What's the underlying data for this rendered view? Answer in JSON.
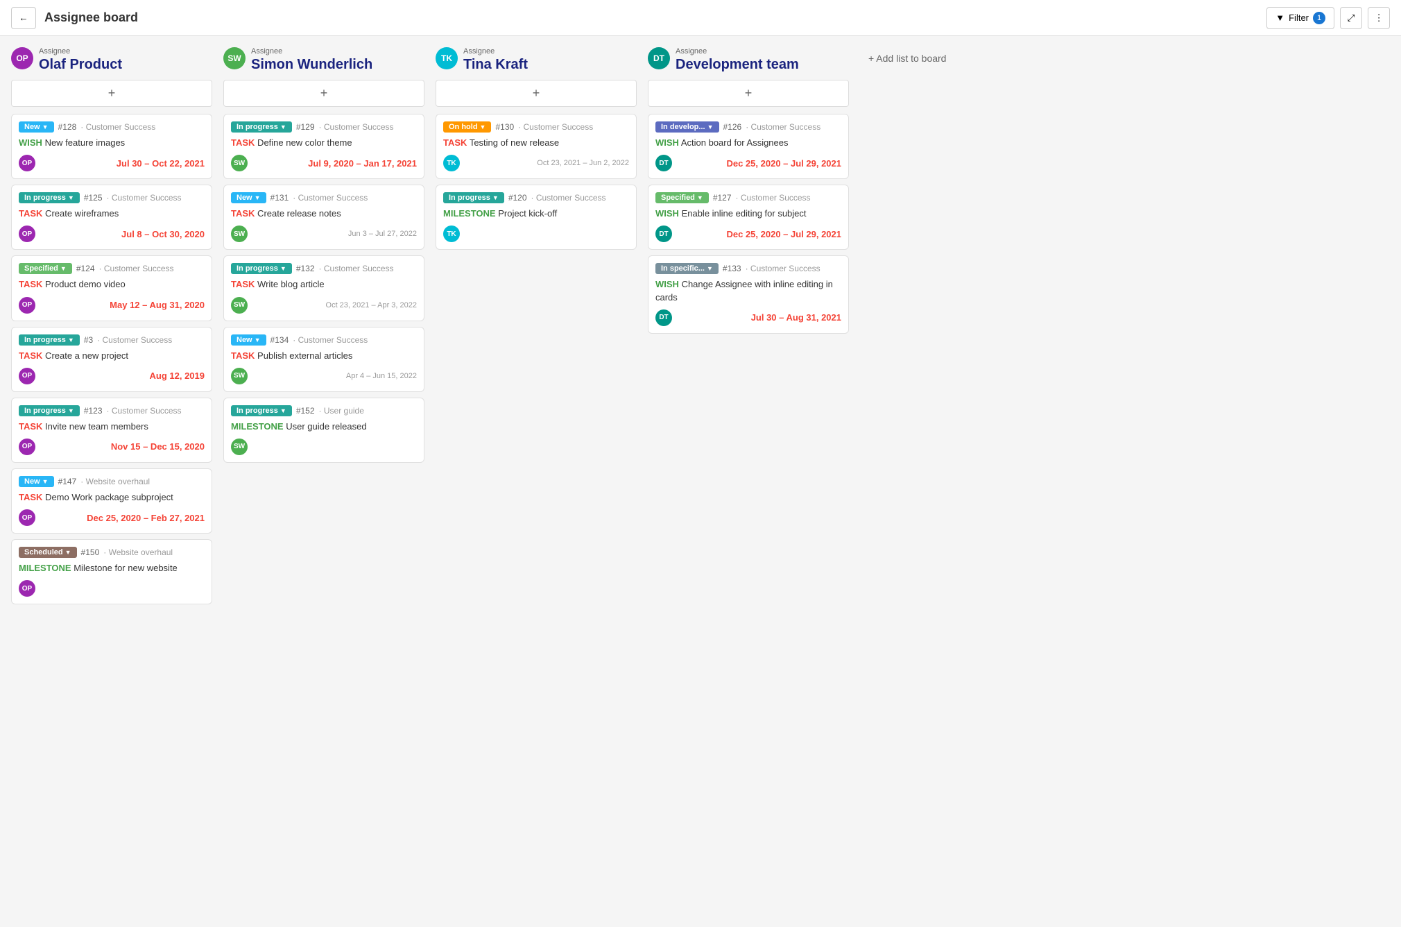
{
  "header": {
    "back_label": "←",
    "title": "Assignee board",
    "filter_label": "Filter",
    "filter_count": "1",
    "expand_icon": "⤢",
    "more_icon": "⋮"
  },
  "add_list_label": "+ Add list to board",
  "columns": [
    {
      "id": "olaf",
      "assignee_label": "Assignee",
      "name": "Olaf Product",
      "avatar_text": "OP",
      "avatar_class": "avatar-op",
      "add_label": "+",
      "cards": [
        {
          "status": "New",
          "status_class": "status-new",
          "number": "#128",
          "project": "· Customer Success",
          "type": "WISH",
          "type_class": "type-wish",
          "title": "New feature images",
          "avatar_text": "OP",
          "avatar_class": "avatar-op avatar-sm",
          "dates": "Jul 30 – Oct 22, 2021",
          "dates_class": "dates-red"
        },
        {
          "status": "In progress",
          "status_class": "status-inprogress",
          "number": "#125",
          "project": "· Customer Success",
          "type": "TASK",
          "type_class": "type-task",
          "title": "Create wireframes",
          "avatar_text": "OP",
          "avatar_class": "avatar-op avatar-sm",
          "dates": "Jul 8 – Oct 30, 2020",
          "dates_class": "dates-red"
        },
        {
          "status": "Specified",
          "status_class": "status-specified",
          "number": "#124",
          "project": "· Customer Success",
          "type": "TASK",
          "type_class": "type-task",
          "title": "Product demo video",
          "avatar_text": "OP",
          "avatar_class": "avatar-op avatar-sm",
          "dates": "May 12 – Aug 31, 2020",
          "dates_class": "dates-red"
        },
        {
          "status": "In progress",
          "status_class": "status-inprogress",
          "number": "#3",
          "project": "· Customer Success",
          "type": "TASK",
          "type_class": "type-task",
          "title": "Create a new project",
          "avatar_text": "OP",
          "avatar_class": "avatar-op avatar-sm",
          "dates": "Aug 12, 2019",
          "dates_class": "dates-red"
        },
        {
          "status": "In progress",
          "status_class": "status-inprogress",
          "number": "#123",
          "project": "· Customer Success",
          "type": "TASK",
          "type_class": "type-task",
          "title": "Invite new team members",
          "avatar_text": "OP",
          "avatar_class": "avatar-op avatar-sm",
          "dates": "Nov 15 – Dec 15, 2020",
          "dates_class": "dates-red"
        },
        {
          "status": "New",
          "status_class": "status-new",
          "number": "#147",
          "project": "· Website overhaul",
          "type": "TASK",
          "type_class": "type-task",
          "title": "Demo Work package subproject",
          "avatar_text": "OP",
          "avatar_class": "avatar-op avatar-sm",
          "dates": "Dec 25, 2020 – Feb 27, 2021",
          "dates_class": "dates-red"
        },
        {
          "status": "Scheduled",
          "status_class": "status-scheduled",
          "number": "#150",
          "project": "· Website overhaul",
          "type": "MILESTONE",
          "type_class": "type-milestone",
          "title": "Milestone for new website",
          "avatar_text": "OP",
          "avatar_class": "avatar-op avatar-sm",
          "dates": "",
          "dates_class": ""
        }
      ]
    },
    {
      "id": "simon",
      "assignee_label": "Assignee",
      "name": "Simon Wunderlich",
      "avatar_text": "SW",
      "avatar_class": "avatar-sw",
      "add_label": "+",
      "cards": [
        {
          "status": "In progress",
          "status_class": "status-inprogress",
          "number": "#129",
          "project": "· Customer Success",
          "type": "TASK",
          "type_class": "type-task",
          "title": "Define new color theme",
          "avatar_text": "SW",
          "avatar_class": "avatar-sw avatar-sm",
          "dates": "Jul 9, 2020 – Jan 17, 2021",
          "dates_class": "dates-red"
        },
        {
          "status": "New",
          "status_class": "status-new",
          "number": "#131",
          "project": "· Customer Success",
          "type": "TASK",
          "type_class": "type-task",
          "title": "Create release notes",
          "avatar_text": "SW",
          "avatar_class": "avatar-sw avatar-sm",
          "dates": "Jun 3 – Jul 27, 2022",
          "dates_class": "card-dates"
        },
        {
          "status": "In progress",
          "status_class": "status-inprogress",
          "number": "#132",
          "project": "· Customer Success",
          "type": "TASK",
          "type_class": "type-task",
          "title": "Write blog article",
          "avatar_text": "SW",
          "avatar_class": "avatar-sw avatar-sm",
          "dates": "Oct 23, 2021 – Apr 3, 2022",
          "dates_class": "card-dates"
        },
        {
          "status": "New",
          "status_class": "status-new",
          "number": "#134",
          "project": "· Customer Success",
          "type": "TASK",
          "type_class": "type-task",
          "title": "Publish external articles",
          "avatar_text": "SW",
          "avatar_class": "avatar-sw avatar-sm",
          "dates": "Apr 4 – Jun 15, 2022",
          "dates_class": "card-dates"
        },
        {
          "status": "In progress",
          "status_class": "status-inprogress",
          "number": "#152",
          "project": "· User guide",
          "type": "MILESTONE",
          "type_class": "type-milestone",
          "title": "User guide released",
          "avatar_text": "SW",
          "avatar_class": "avatar-sw avatar-sm",
          "dates": "",
          "dates_class": ""
        }
      ]
    },
    {
      "id": "tina",
      "assignee_label": "Assignee",
      "name": "Tina Kraft",
      "avatar_text": "TK",
      "avatar_class": "avatar-tk",
      "add_label": "+",
      "cards": [
        {
          "status": "On hold",
          "status_class": "status-onhold",
          "number": "#130",
          "project": "· Customer Success",
          "type": "TASK",
          "type_class": "type-task",
          "title": "Testing of new release",
          "avatar_text": "TK",
          "avatar_class": "avatar-tk avatar-sm",
          "dates": "Oct 23, 2021 – Jun 2, 2022",
          "dates_class": "card-dates"
        },
        {
          "status": "In progress",
          "status_class": "status-inprogress",
          "number": "#120",
          "project": "· Customer Success",
          "type": "MILESTONE",
          "type_class": "type-milestone",
          "title": "Project kick-off",
          "avatar_text": "TK",
          "avatar_class": "avatar-tk avatar-sm",
          "dates": "",
          "dates_class": ""
        }
      ]
    },
    {
      "id": "devteam",
      "assignee_label": "Assignee",
      "name": "Development team",
      "avatar_text": "DT",
      "avatar_class": "avatar-dt",
      "add_label": "+",
      "cards": [
        {
          "status": "In develop...",
          "status_class": "status-indevelop",
          "number": "#126",
          "project": "· Customer Success",
          "type": "WISH",
          "type_class": "type-wish",
          "title": "Action board for Assignees",
          "avatar_text": "DT",
          "avatar_class": "avatar-dt avatar-sm",
          "dates": "Dec 25, 2020 – Jul 29, 2021",
          "dates_class": "dates-red"
        },
        {
          "status": "Specified",
          "status_class": "status-specified",
          "number": "#127",
          "project": "· Customer Success",
          "type": "WISH",
          "type_class": "type-wish",
          "title": "Enable inline editing for subject",
          "avatar_text": "DT",
          "avatar_class": "avatar-dt avatar-sm",
          "dates": "Dec 25, 2020 – Jul 29, 2021",
          "dates_class": "dates-red"
        },
        {
          "status": "In specific...",
          "status_class": "status-inspecific",
          "number": "#133",
          "project": "· Customer Success",
          "type": "WISH",
          "type_class": "type-wish",
          "title": "Change Assignee with inline editing in cards",
          "avatar_text": "DT",
          "avatar_class": "avatar-dt avatar-sm",
          "dates": "Jul 30 – Aug 31, 2021",
          "dates_class": "dates-red"
        }
      ]
    }
  ]
}
